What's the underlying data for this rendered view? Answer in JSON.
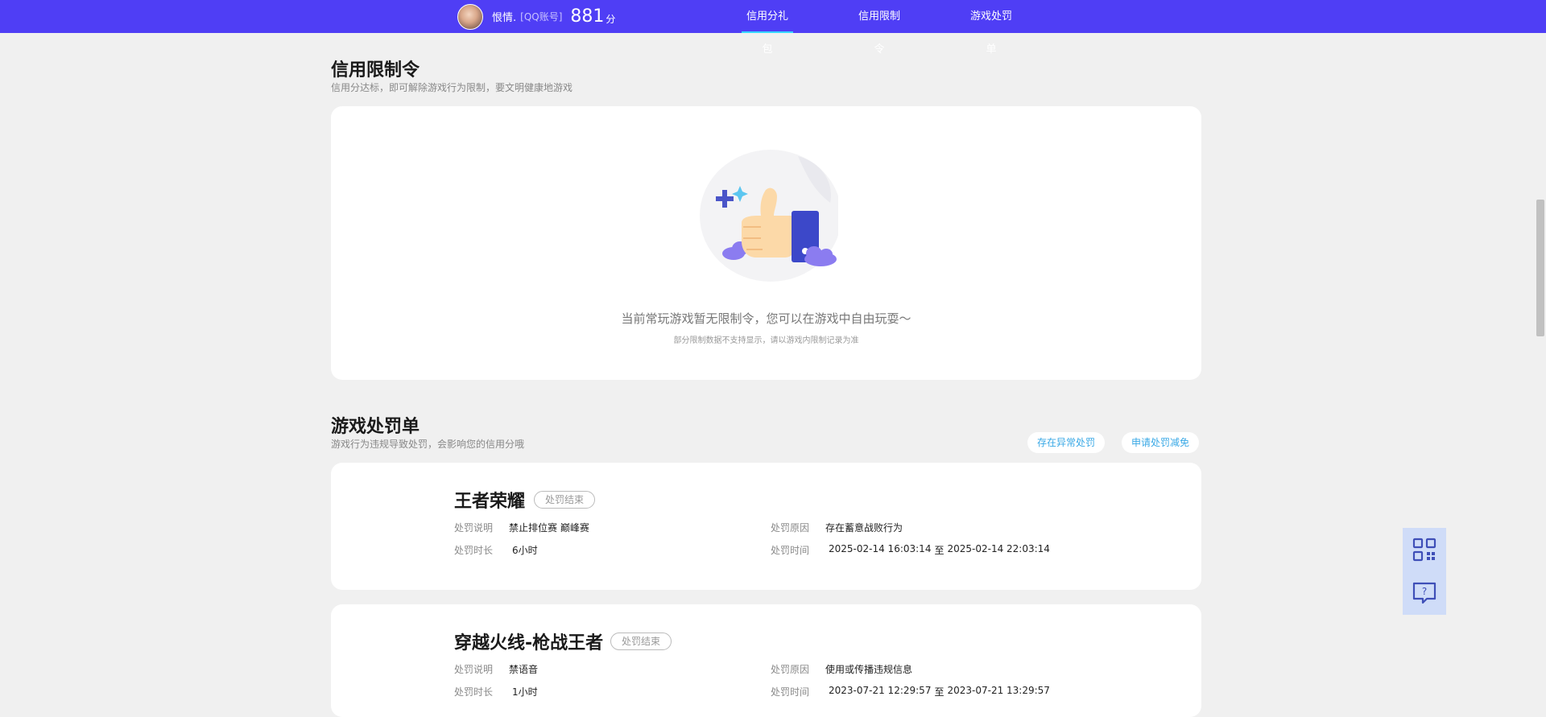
{
  "header": {
    "nickname": "恨情.",
    "account_type": "[QQ账号]",
    "score": "881",
    "score_unit": "分",
    "nav": [
      {
        "label": "信用分礼包",
        "active": true
      },
      {
        "label": "信用限制令",
        "active": false
      },
      {
        "label": "游戏处罚单",
        "active": false
      }
    ]
  },
  "restriction": {
    "title": "信用限制令",
    "subtitle": "信用分达标，即可解除游戏行为限制，要文明健康地游戏",
    "empty_main": "当前常玩游戏暂无限制令，您可以在游戏中自由玩耍～",
    "empty_sub": "部分限制数据不支持显示，请以游戏内限制记录为准"
  },
  "penalty": {
    "title": "游戏处罚单",
    "subtitle": "游戏行为违规导致处罚，会影响您的信用分哦",
    "buttons": [
      "存在异常处罚",
      "申请处罚减免"
    ],
    "labels": {
      "desc": "处罚说明",
      "duration": "处罚时长",
      "reason": "处罚原因",
      "time": "处罚时间",
      "to": "至"
    },
    "items": [
      {
        "game": "王者荣耀",
        "status": "处罚结束",
        "desc": "禁止排位赛 巅峰赛",
        "duration": "6小时",
        "reason": "存在蓄意战败行为",
        "start": "2025-02-14 16:03:14",
        "end": "2025-02-14 22:03:14"
      },
      {
        "game": "穿越火线-枪战王者",
        "status": "处罚结束",
        "desc": "禁语音",
        "duration": "1小时",
        "reason": "使用或传播违规信息",
        "start": "2023-07-21 12:29:57",
        "end": "2023-07-21 13:29:57"
      }
    ]
  },
  "float": {
    "icons": [
      "qrcode-icon",
      "help-chat-icon"
    ]
  },
  "colors": {
    "header_bg": "#4f3ef5",
    "accent": "#36d6ff",
    "link": "#38a8e6",
    "page_bg": "#f0f0f0"
  }
}
